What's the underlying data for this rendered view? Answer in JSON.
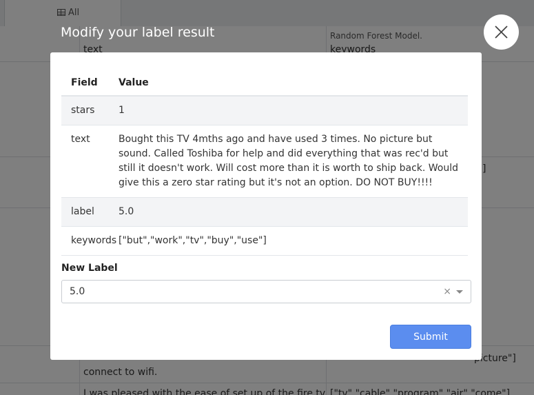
{
  "background": {
    "tab_label": "All",
    "header_col_text": "text",
    "header_col_model": "Random Forest Model.",
    "header_col_keywords": "keywords",
    "row_bottom_text": "connect to wifi.",
    "row_bottom_keywords": "picture\"]",
    "row_last_text": "I was pleased with the ease of set up of the fire tv",
    "row_last_keywords": "[\"tv\",\"cable\",\"program\",\"air\",\"come\"]",
    "row_mid_keywords": "]"
  },
  "modal": {
    "title": "Modify your label result",
    "table": {
      "header_field": "Field",
      "header_value": "Value",
      "rows": [
        {
          "field": "stars",
          "value": "1"
        },
        {
          "field": "text",
          "value": "Bought this TV 4mths ago and have used 3 times. No picture but sound. Called Toshiba for help and did everything that was rec'd but still it doesn't work. Will cost more than it is worth to ship back. Would give this a zero star rating but it's not an option. DO NOT BUY!!!!"
        },
        {
          "field": "label",
          "value": "5.0"
        },
        {
          "field": "keywords",
          "value": "[\"but\",\"work\",\"tv\",\"buy\",\"use\"]"
        }
      ]
    },
    "new_label_title": "New Label",
    "new_label_value": "5.0",
    "clear_symbol": "×",
    "submit_label": "Submit"
  },
  "colors": {
    "accent": "#5b8def",
    "overlay": "rgba(0,0,0,0.5)"
  }
}
